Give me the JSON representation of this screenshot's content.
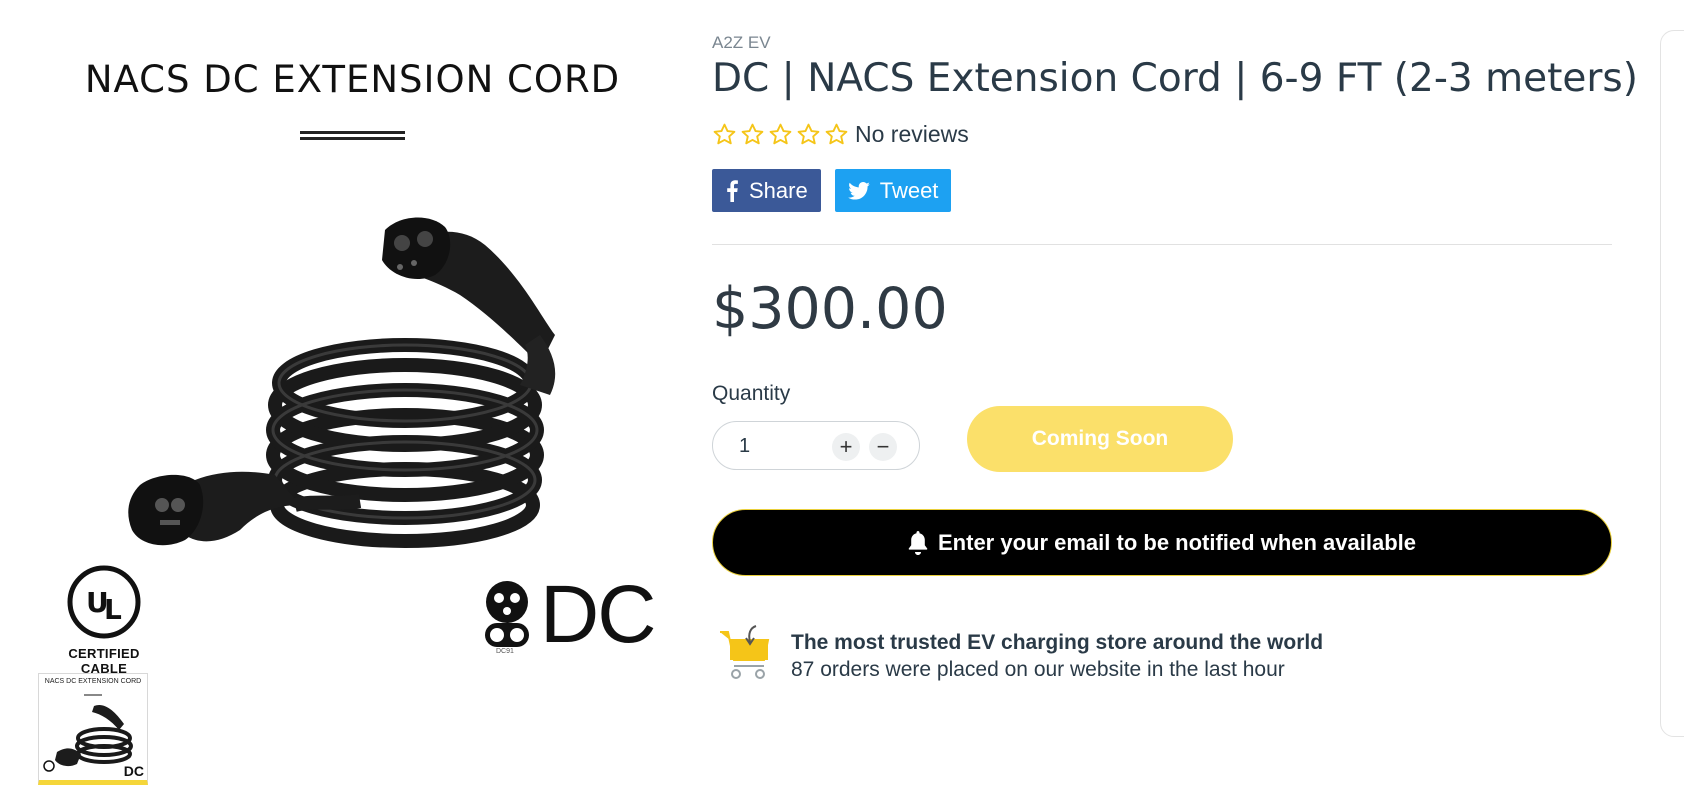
{
  "media": {
    "hero_title": "NACS DC EXTENSION CORD",
    "ul_cert_label": "CERTIFIED CABLE",
    "dc_label": "DC",
    "dc_small_label": "DC91",
    "thumb_title": "NACS DC EXTENSION CORD",
    "thumb_dc_label": "DC"
  },
  "product": {
    "vendor": "A2Z EV",
    "title": "DC | NACS Extension Cord | 6-9 FT (2-3 meters)",
    "rating": {
      "stars": 5,
      "filled": 0,
      "reviews_label": "No reviews"
    },
    "share_label": "Share",
    "tweet_label": "Tweet",
    "price": "$300.00",
    "quantity_label": "Quantity",
    "quantity_value": "1",
    "coming_soon_label": "Coming Soon",
    "notify_label": "Enter your email to be notified when available"
  },
  "trust": {
    "title": "The most trusted EV charging store around the world",
    "subtitle": "87 orders were placed on our website in the last hour"
  },
  "colors": {
    "facebook": "#3b5998",
    "twitter": "#1da1f2",
    "star": "#f5c518",
    "coming_soon": "#fbe06a",
    "notify_bg": "#000000",
    "notify_border": "#e9cf3a"
  }
}
